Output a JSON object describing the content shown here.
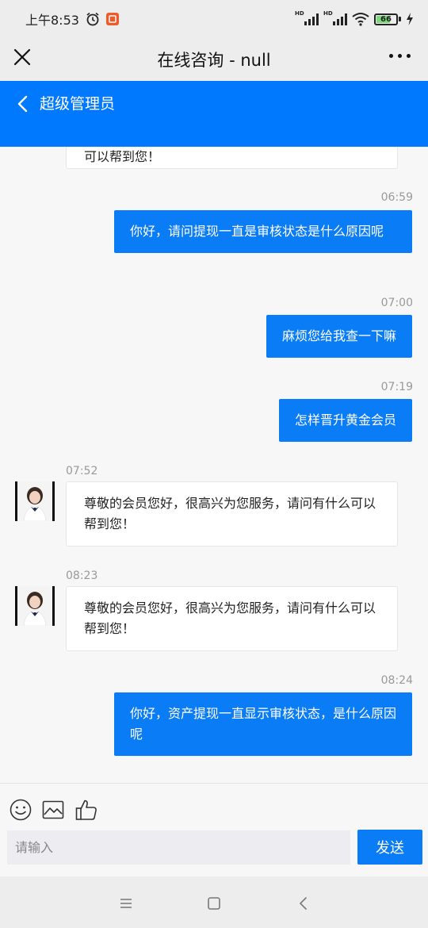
{
  "status_bar": {
    "time": "上午8:53",
    "network_label": "HD",
    "battery_level": "66",
    "icons": [
      "alarm-icon",
      "app-notification-icon",
      "signal-icon",
      "wifi-icon",
      "battery-icon",
      "charging-icon"
    ]
  },
  "title_bar": {
    "title": "在线咨询 - null",
    "icons": [
      "close-icon",
      "more-icon"
    ]
  },
  "chat_header": {
    "contact_name": "超级管理员",
    "icon": "back-chevron-icon"
  },
  "messages": [
    {
      "direction": "in",
      "time": "",
      "text": "可以帮到您！"
    },
    {
      "direction": "out",
      "time": "06:59",
      "text": "你好，请问提现一直是审核状态是什么原因呢"
    },
    {
      "direction": "out",
      "time": "07:00",
      "text": "麻烦您给我查一下嘛"
    },
    {
      "direction": "out",
      "time": "07:19",
      "text": "怎样晋升黄金会员"
    },
    {
      "direction": "in",
      "time": "07:52",
      "text": "尊敬的会员您好，很高兴为您服务，请问有什么可以帮到您！"
    },
    {
      "direction": "in",
      "time": "08:23",
      "text": "尊敬的会员您好，很高兴为您服务，请问有什么可以帮到您！"
    },
    {
      "direction": "out",
      "time": "08:24",
      "text": "你好，资产提现一直显示审核状态，是什么原因呢"
    }
  ],
  "composer": {
    "tools": [
      "emoji-icon",
      "image-icon",
      "thumbs-up-icon"
    ],
    "placeholder": "请输入",
    "value": "",
    "send_label": "发送"
  },
  "nav_bar": {
    "icons": [
      "menu-icon",
      "home-icon",
      "back-icon"
    ]
  },
  "colors": {
    "accent": "#0079fe",
    "outgoing_bubble": "#0a7cf5",
    "background": "#f7f7f7",
    "bar": "#ededed"
  }
}
